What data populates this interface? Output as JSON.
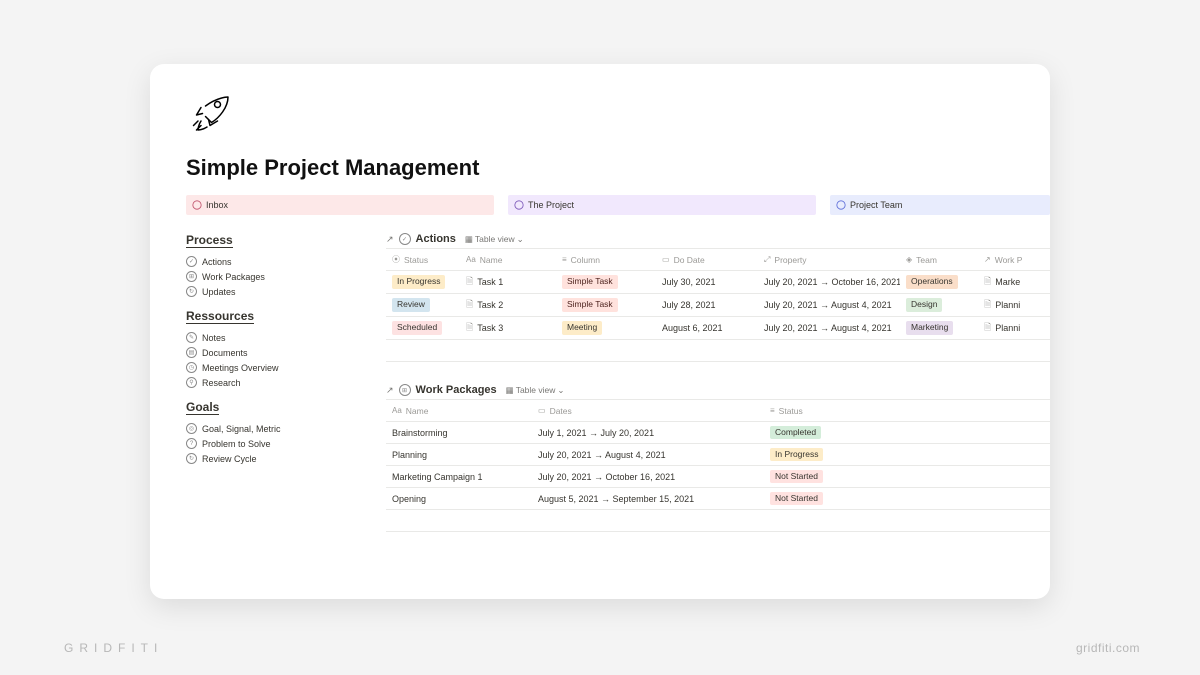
{
  "page": {
    "title": "Simple Project Management"
  },
  "sections": [
    {
      "label": "Inbox"
    },
    {
      "label": "The Project"
    },
    {
      "label": "Project Team"
    }
  ],
  "sidebar": {
    "groups": [
      {
        "heading": "Process",
        "items": [
          {
            "label": "Actions"
          },
          {
            "label": "Work Packages"
          },
          {
            "label": "Updates"
          }
        ]
      },
      {
        "heading": "Ressources",
        "items": [
          {
            "label": "Notes"
          },
          {
            "label": "Documents"
          },
          {
            "label": "Meetings Overview"
          },
          {
            "label": "Research"
          }
        ]
      },
      {
        "heading": "Goals",
        "items": [
          {
            "label": "Goal, Signal, Metric"
          },
          {
            "label": "Problem to Solve"
          },
          {
            "label": "Review Cycle"
          }
        ]
      }
    ]
  },
  "actions": {
    "title": "Actions",
    "view": "Table view",
    "columns": {
      "status": "Status",
      "name": "Name",
      "column": "Column",
      "dodate": "Do Date",
      "property": "Property",
      "team": "Team",
      "workp": "Work P"
    },
    "rows": [
      {
        "status": "In Progress",
        "status_cls": "t-yellow",
        "name": "Task 1",
        "col": "Simple Task",
        "col_cls": "t-red",
        "dodate": "July 30, 2021",
        "property": "July 20, 2021 → October 16, 2021",
        "team": "Operations",
        "team_cls": "t-orange",
        "workp": "Marke"
      },
      {
        "status": "Review",
        "status_cls": "t-blue",
        "name": "Task 2",
        "col": "Simple Task",
        "col_cls": "t-red",
        "dodate": "July 28, 2021",
        "property": "July 20, 2021 → August 4, 2021",
        "team": "Design",
        "team_cls": "t-green",
        "workp": "Planni"
      },
      {
        "status": "Scheduled",
        "status_cls": "t-pink",
        "name": "Task 3",
        "col": "Meeting",
        "col_cls": "t-yellow",
        "dodate": "August 6, 2021",
        "property": "July 20, 2021 → August 4, 2021",
        "team": "Marketing",
        "team_cls": "t-purple",
        "workp": "Planni"
      }
    ]
  },
  "workpackages": {
    "title": "Work Packages",
    "view": "Table view",
    "columns": {
      "name": "Name",
      "dates": "Dates",
      "status": "Status"
    },
    "rows": [
      {
        "name": "Brainstorming",
        "dates": "July 1, 2021 → July 20, 2021",
        "status": "Completed",
        "status_cls": "t-green2"
      },
      {
        "name": "Planning",
        "dates": "July 20, 2021 → August 4, 2021",
        "status": "In Progress",
        "status_cls": "t-prog"
      },
      {
        "name": "Marketing Campaign 1",
        "dates": "July 20, 2021 → October 16, 2021",
        "status": "Not Started",
        "status_cls": "t-notstart"
      },
      {
        "name": "Opening",
        "dates": "August 5, 2021 → September 15, 2021",
        "status": "Not Started",
        "status_cls": "t-notstart"
      }
    ]
  },
  "footer": {
    "brand": "GRIDFITI",
    "url": "gridfiti.com"
  }
}
